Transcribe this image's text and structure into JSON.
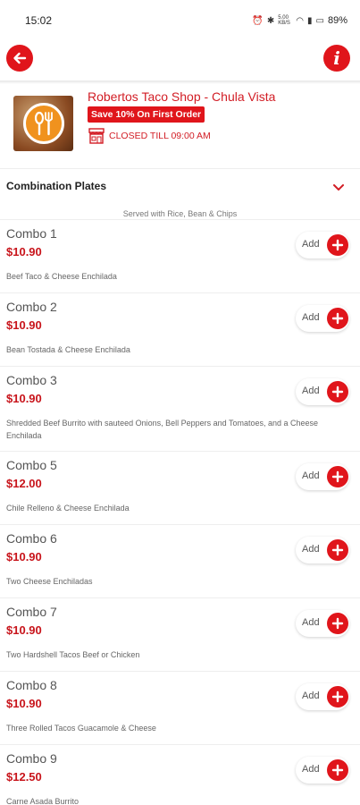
{
  "status_bar": {
    "time": "15:02",
    "data_speed": "5.00 KB/S",
    "battery": "89%"
  },
  "header": {
    "back_icon": "arrow-left-icon",
    "info_icon": "info-icon"
  },
  "store": {
    "name": "Robertos Taco Shop - Chula Vista",
    "promo": "Save 10% On First Order",
    "status": "CLOSED TILL 09:00 AM",
    "logo_icon": "fork-spoon-icon",
    "status_icon": "store-icon"
  },
  "category": {
    "title": "Combination Plates",
    "subtitle": "Served with Rice, Bean & Chips",
    "chevron_icon": "chevron-down-icon"
  },
  "add_label": "Add",
  "items": [
    {
      "name": "Combo 1",
      "price": "$10.90",
      "desc": "Beef Taco & Cheese Enchilada"
    },
    {
      "name": "Combo 2",
      "price": "$10.90",
      "desc": "Bean Tostada & Cheese Enchilada"
    },
    {
      "name": "Combo 3",
      "price": "$10.90",
      "desc": "Shredded Beef Burrito with sauteed Onions, Bell Peppers and Tomatoes, and a Cheese Enchilada"
    },
    {
      "name": "Combo 5",
      "price": "$12.00",
      "desc": "Chile Relleno & Cheese Enchilada"
    },
    {
      "name": "Combo 6",
      "price": "$10.90",
      "desc": "Two Cheese Enchiladas"
    },
    {
      "name": "Combo 7",
      "price": "$10.90",
      "desc": "Two Hardshell Tacos Beef or Chicken"
    },
    {
      "name": "Combo 8",
      "price": "$10.90",
      "desc": "Three Rolled Tacos Guacamole & Cheese"
    },
    {
      "name": "Combo 9",
      "price": "$12.50",
      "desc": "Carne Asada Burrito"
    }
  ],
  "colors": {
    "brand_red": "#e0151b",
    "price_red": "#c8141b"
  }
}
